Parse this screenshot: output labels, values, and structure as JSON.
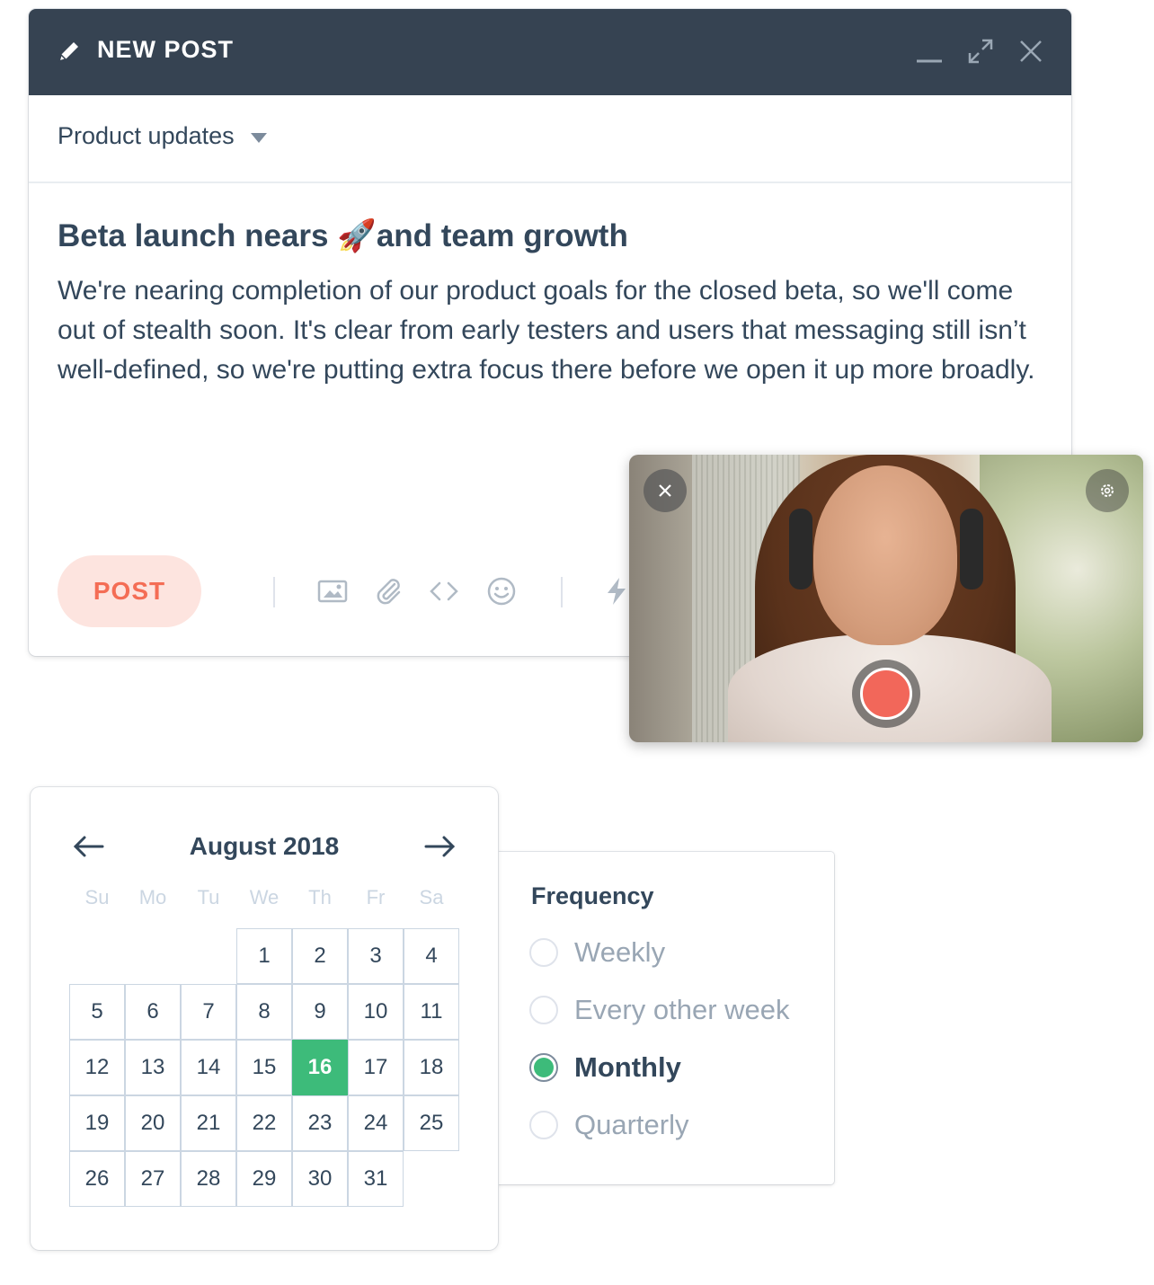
{
  "post_window": {
    "title": "NEW POST",
    "category": "Product updates",
    "heading_before": "Beta launch nears ",
    "heading_emoji": "🚀",
    "heading_after": "and team growth",
    "body": "We're nearing completion of our product goals for the closed beta, so we'll come out of stealth soon. It's clear from early testers and users that messaging still isn’t well-defined, so we're putting extra focus there before we open it up more broadly.",
    "post_button": "POST",
    "icons": [
      "pencil-icon",
      "minimize-icon",
      "expand-icon",
      "close-icon",
      "caret-down-icon",
      "image-icon",
      "attachment-icon",
      "code-icon",
      "emoji-icon",
      "lightning-icon"
    ]
  },
  "video": {
    "icons": [
      "close-icon",
      "gear-icon",
      "record-icon"
    ]
  },
  "calendar": {
    "month": "August 2018",
    "weekdays": [
      "Su",
      "Mo",
      "Tu",
      "We",
      "Th",
      "Fr",
      "Sa"
    ],
    "days": [
      "1",
      "2",
      "3",
      "4",
      "5",
      "6",
      "7",
      "8",
      "9",
      "10",
      "11",
      "12",
      "13",
      "14",
      "15",
      "16",
      "17",
      "18",
      "19",
      "20",
      "21",
      "22",
      "23",
      "24",
      "25",
      "26",
      "27",
      "28",
      "29",
      "30",
      "31"
    ],
    "first_weekday_index": 3,
    "selected_day": "16",
    "selected_color": "#3dbb7a"
  },
  "frequency": {
    "title": "Frequency",
    "options": [
      "Weekly",
      "Every other week",
      "Monthly",
      "Quarterly"
    ],
    "selected": "Monthly"
  },
  "colors": {
    "header": "#364352",
    "accent": "#f46d55",
    "text": "#33475b"
  }
}
